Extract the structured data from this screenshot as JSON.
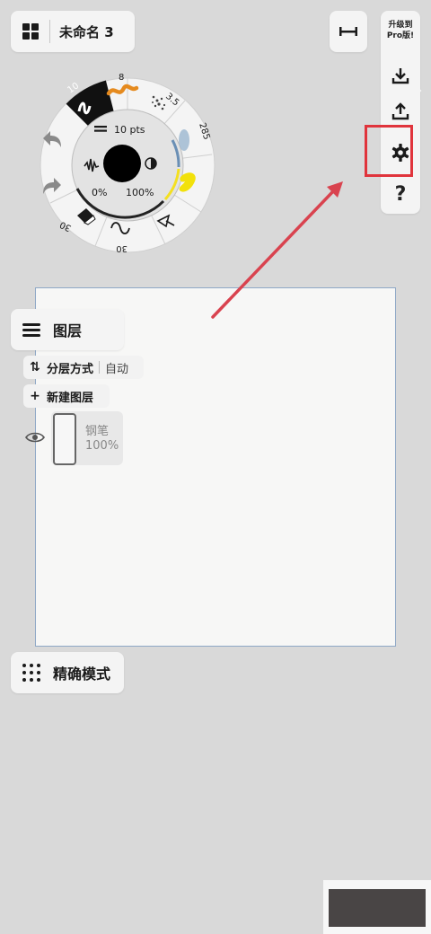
{
  "header": {
    "doc_title": "未命名 3"
  },
  "right_bar": {
    "upgrade_label": "升级到\nPro版!",
    "help_label": "?"
  },
  "brush_wheel": {
    "size_label": "10 pts",
    "opacity_min": "0%",
    "opacity_max": "100%",
    "tools": [
      {
        "label": "10",
        "icon": "pen-icon"
      },
      {
        "label": "8",
        "icon": "marker-stroke-icon"
      },
      {
        "label": "3.5",
        "icon": "airbrush-icon"
      },
      {
        "label": "285",
        "icon": "watercolor-icon"
      },
      {
        "label": "",
        "icon": "yellow-brush-icon"
      },
      {
        "label": "",
        "icon": "selection-icon"
      },
      {
        "label": "30",
        "icon": "curve-icon"
      },
      {
        "label": "30",
        "icon": "eraser-icon"
      }
    ]
  },
  "layers": {
    "title": "图层",
    "sort_label": "分层方式",
    "sort_value": "自动",
    "new_layer_label": "新建图层",
    "layer_name": "钢笔",
    "layer_opacity": "100%"
  },
  "precise": {
    "label": "精确模式"
  },
  "colors": {
    "highlight": "#e0343c",
    "canvas_border": "#8fa8c6",
    "background": "#d9d9d9"
  }
}
